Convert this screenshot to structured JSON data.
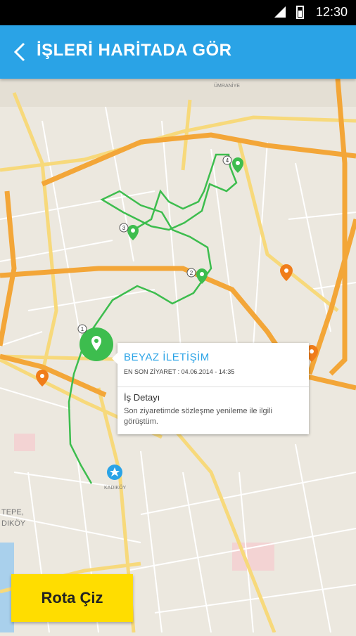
{
  "status_bar": {
    "time": "12:30"
  },
  "header": {
    "title": "İŞLERİ HARİTADA GÖR"
  },
  "map": {
    "labels": {
      "umraniye": "ÜMRANİYE",
      "kadikoy": "KADIKÖY",
      "tepe": "TEPE,",
      "dikoy": "DIKÖY"
    },
    "markers": [
      {
        "number": "1"
      },
      {
        "number": "2"
      },
      {
        "number": "3"
      },
      {
        "number": "4"
      }
    ]
  },
  "info_card": {
    "name": "BEYAZ İLETİŞİM",
    "last_visit": "EN SON ZİYARET : 04.06.2014 - 14:35",
    "detail_title": "İş Detayı",
    "detail_text": "Son ziyaretimde sözleşme yenileme ile ilgili görüştüm."
  },
  "actions": {
    "route_button": "Rota Çiz"
  },
  "colors": {
    "accent": "#2aa3e6",
    "route": "#3dbd4e",
    "marker_green": "#3dbd4e",
    "marker_orange": "#f07d1a",
    "button_yellow": "#ffdd00"
  }
}
